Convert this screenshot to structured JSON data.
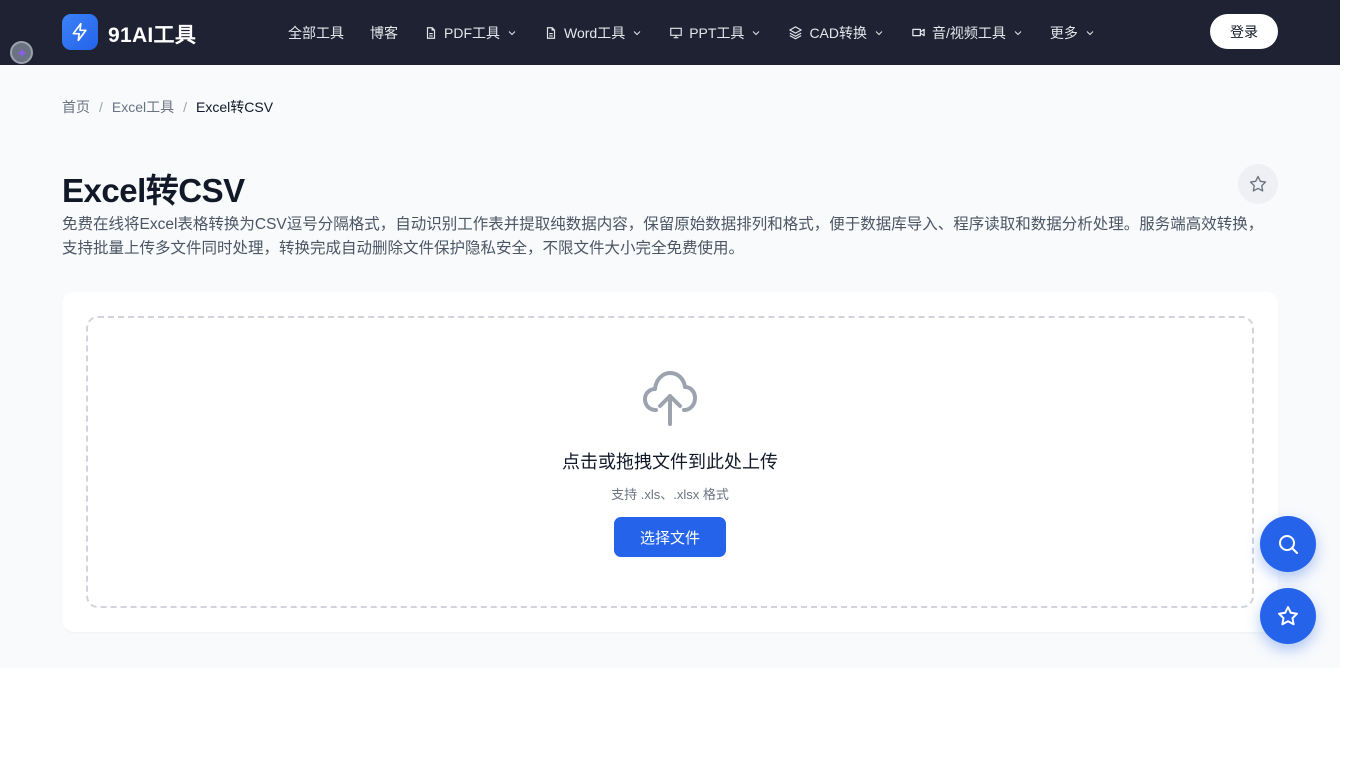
{
  "header": {
    "logo_text": "91AI工具",
    "nav": [
      {
        "label": "全部工具",
        "icon": "",
        "dropdown": false
      },
      {
        "label": "博客",
        "icon": "",
        "dropdown": false
      },
      {
        "label": "PDF工具",
        "icon": "file-icon",
        "dropdown": true
      },
      {
        "label": "Word工具",
        "icon": "file-text-icon",
        "dropdown": true
      },
      {
        "label": "PPT工具",
        "icon": "presentation-icon",
        "dropdown": true
      },
      {
        "label": "CAD转换",
        "icon": "layers-icon",
        "dropdown": true
      },
      {
        "label": "音/视频工具",
        "icon": "video-icon",
        "dropdown": true
      },
      {
        "label": "更多",
        "icon": "",
        "dropdown": true
      }
    ],
    "login_label": "登录"
  },
  "breadcrumb": {
    "home": "首页",
    "category": "Excel工具",
    "current": "Excel转CSV",
    "separator": "/"
  },
  "main": {
    "title": "Excel转CSV",
    "description": "免费在线将Excel表格转换为CSV逗号分隔格式，自动识别工作表并提取纯数据内容，保留原始数据排列和格式，便于数据库导入、程序读取和数据分析处理。服务端高效转换，支持批量上传多文件同时处理，转换完成自动删除文件保护隐私安全，不限文件大小完全免费使用。"
  },
  "upload": {
    "title": "点击或拖拽文件到此处上传",
    "hint": "支持 .xls、.xlsx 格式",
    "button_label": "选择文件"
  },
  "colors": {
    "header_bg": "#1e2233",
    "accent": "#2563eb",
    "page_bg": "#f8fafc"
  }
}
